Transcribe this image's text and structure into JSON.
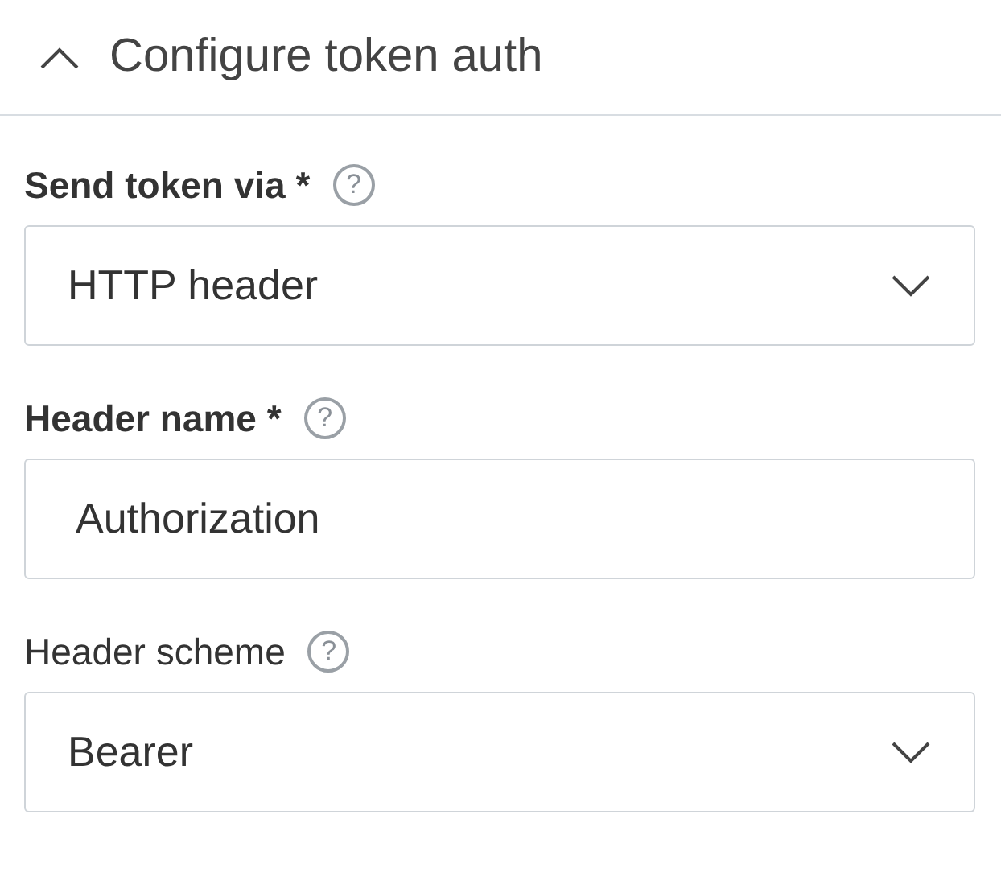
{
  "section": {
    "title": "Configure token auth",
    "expanded": true
  },
  "fields": [
    {
      "kind": "select",
      "label": "Send token via *",
      "required": true,
      "help": "?",
      "value": "HTTP header"
    },
    {
      "kind": "text",
      "label": "Header name *",
      "required": true,
      "help": "?",
      "value": "Authorization"
    },
    {
      "kind": "select",
      "label": "Header scheme",
      "required": false,
      "help": "?",
      "value": "Bearer"
    }
  ]
}
